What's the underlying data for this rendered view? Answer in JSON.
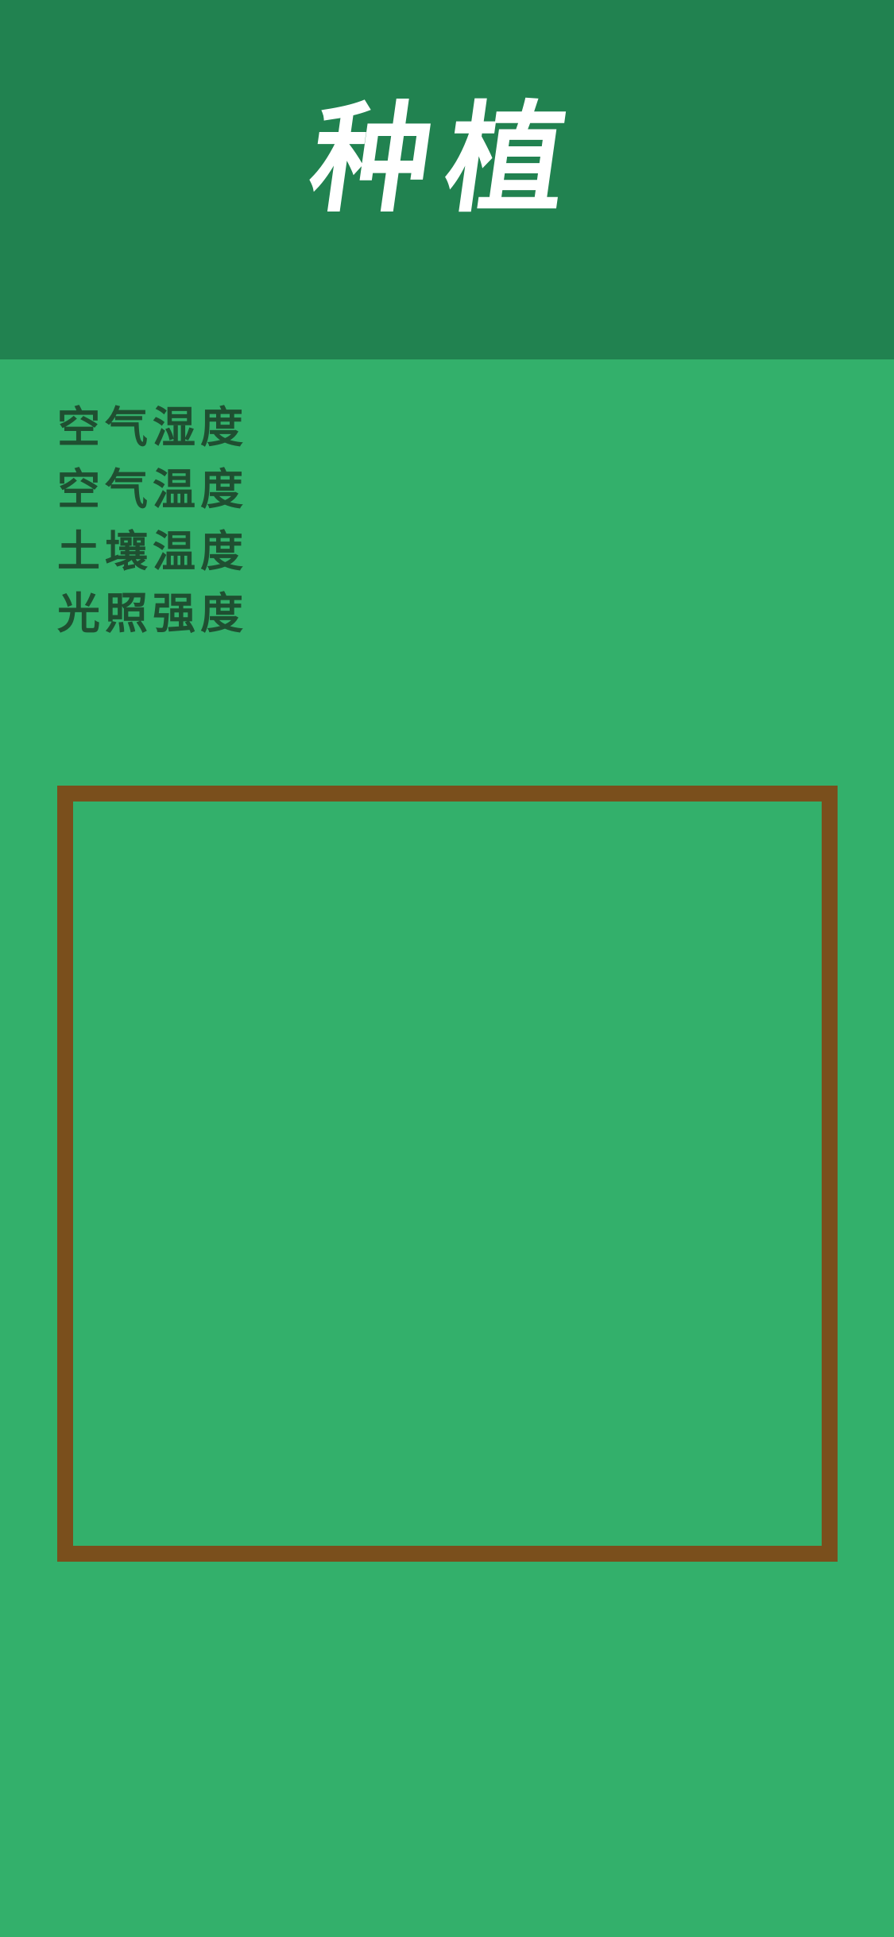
{
  "header": {
    "title": "种植"
  },
  "sensors": {
    "items": [
      {
        "label": "空气湿度"
      },
      {
        "label": "空气温度"
      },
      {
        "label": "土壤温度"
      },
      {
        "label": "光照强度"
      }
    ]
  },
  "colors": {
    "header_background": "#218250",
    "page_background": "#33b06b",
    "sensor_text": "#1f4f31",
    "frame_border": "#7a4f1c",
    "title_text": "#ffffff"
  }
}
